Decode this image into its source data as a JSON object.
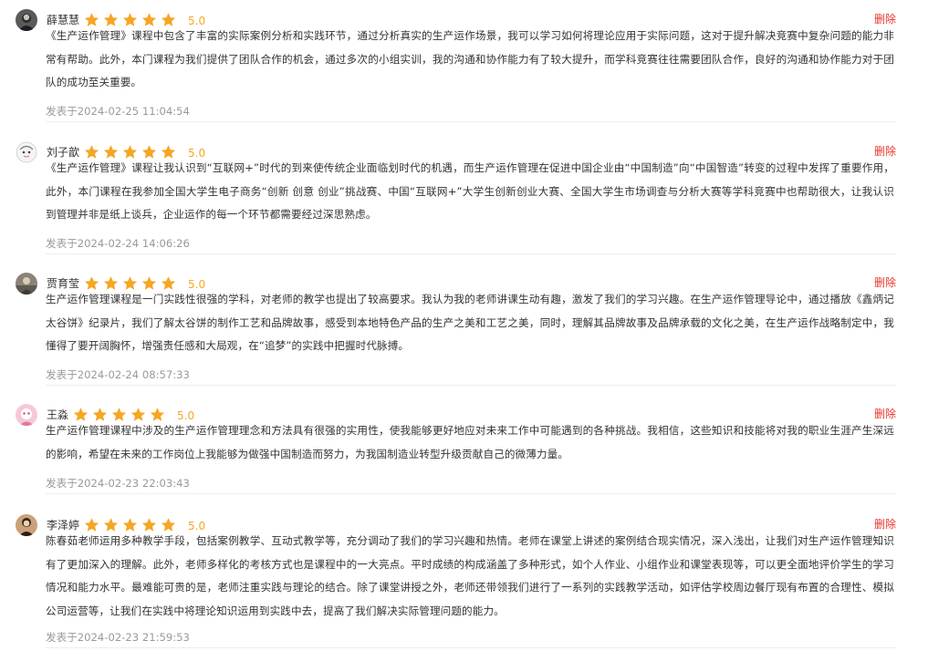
{
  "delete_label": "删除",
  "accent_colors": {
    "star": "#f5a623",
    "score": "#f5a623",
    "delete": "#e8352e",
    "time": "#999999"
  },
  "reviews": [
    {
      "name": "薛慧慧",
      "rating": 5,
      "score": "5.0",
      "content": "《生产运作管理》课程中包含了丰富的实际案例分析和实践环节，通过分析真实的生产运作场景，我可以学习如何将理论应用于实际问题，这对于提升解决竞赛中复杂问题的能力非常有帮助。此外，本门课程为我们提供了团队合作的机会，通过多次的小组实训，我的沟通和协作能力有了较大提升，而学科竞赛往往需要团队合作，良好的沟通和协作能力对于团队的成功至关重要。",
      "time": "发表于2024-02-25 11:04:54",
      "avatar_icon": "portrait-avatar"
    },
    {
      "name": "刘子歆",
      "rating": 5,
      "score": "5.0",
      "content": "《生产运作管理》课程让我认识到“互联网+”时代的到来使传统企业面临划时代的机遇，而生产运作管理在促进中国企业由“中国制造”向“中国智造”转变的过程中发挥了重要作用，此外，本门课程在我参加全国大学生电子商务“创新 创意 创业”挑战赛、中国“互联网+”大学生创新创业大赛、全国大学生市场调查与分析大赛等学科竞赛中也帮助很大，让我认识到管理并非是纸上谈兵，企业运作的每一个环节都需要经过深思熟虑。",
      "time": "发表于2024-02-24 14:06:26",
      "avatar_icon": "cartoon-avatar"
    },
    {
      "name": "贾育莹",
      "rating": 5,
      "score": "5.0",
      "content": "生产运作管理课程是一门实践性很强的学科，对老师的教学也提出了较高要求。我认为我的老师讲课生动有趣，激发了我们的学习兴趣。在生产运作管理导论中，通过播放《鑫炳记太谷饼》纪录片，我们了解太谷饼的制作工艺和品牌故事，感受到本地特色产品的生产之美和工艺之美，同时，理解其品牌故事及品牌承载的文化之美，在生产运作战略制定中，我懂得了要开阔胸怀，增强责任感和大局观，在“追梦”的实践中把握时代脉搏。",
      "time": "发表于2024-02-24 08:57:33",
      "avatar_icon": "photo-avatar"
    },
    {
      "name": "王淼",
      "rating": 5,
      "score": "5.0",
      "content": "生产运作管理课程中涉及的生产运作管理理念和方法具有很强的实用性，使我能够更好地应对未来工作中可能遇到的各种挑战。我相信，这些知识和技能将对我的职业生涯产生深远的影响，希望在未来的工作岗位上我能够为做强中国制造而努力，为我国制造业转型升级贡献自己的微薄力量。",
      "time": "发表于2024-02-23 22:03:43",
      "avatar_icon": "pink-avatar"
    },
    {
      "name": "李泽婷",
      "rating": 5,
      "score": "5.0",
      "content": "陈春茹老师运用多种教学手段，包括案例教学、互动式教学等，充分调动了我们的学习兴趣和热情。老师在课堂上讲述的案例结合现实情况，深入浅出，让我们对生产运作管理知识有了更加深入的理解。此外，老师多样化的考核方式也是课程中的一大亮点。平时成绩的构成涵盖了多种形式，如个人作业、小组作业和课堂表现等，可以更全面地评价学生的学习情况和能力水平。最难能可贵的是，老师注重实践与理论的结合。除了课堂讲授之外，老师还带领我们进行了一系列的实践教学活动，如评估学校周边餐厅现有布置的合理性、模拟公司运营等，让我们在实践中将理论知识运用到实践中去，提高了我们解决实际管理问题的能力。",
      "time": "发表于2024-02-23 21:59:53",
      "avatar_icon": "brown-avatar"
    }
  ]
}
